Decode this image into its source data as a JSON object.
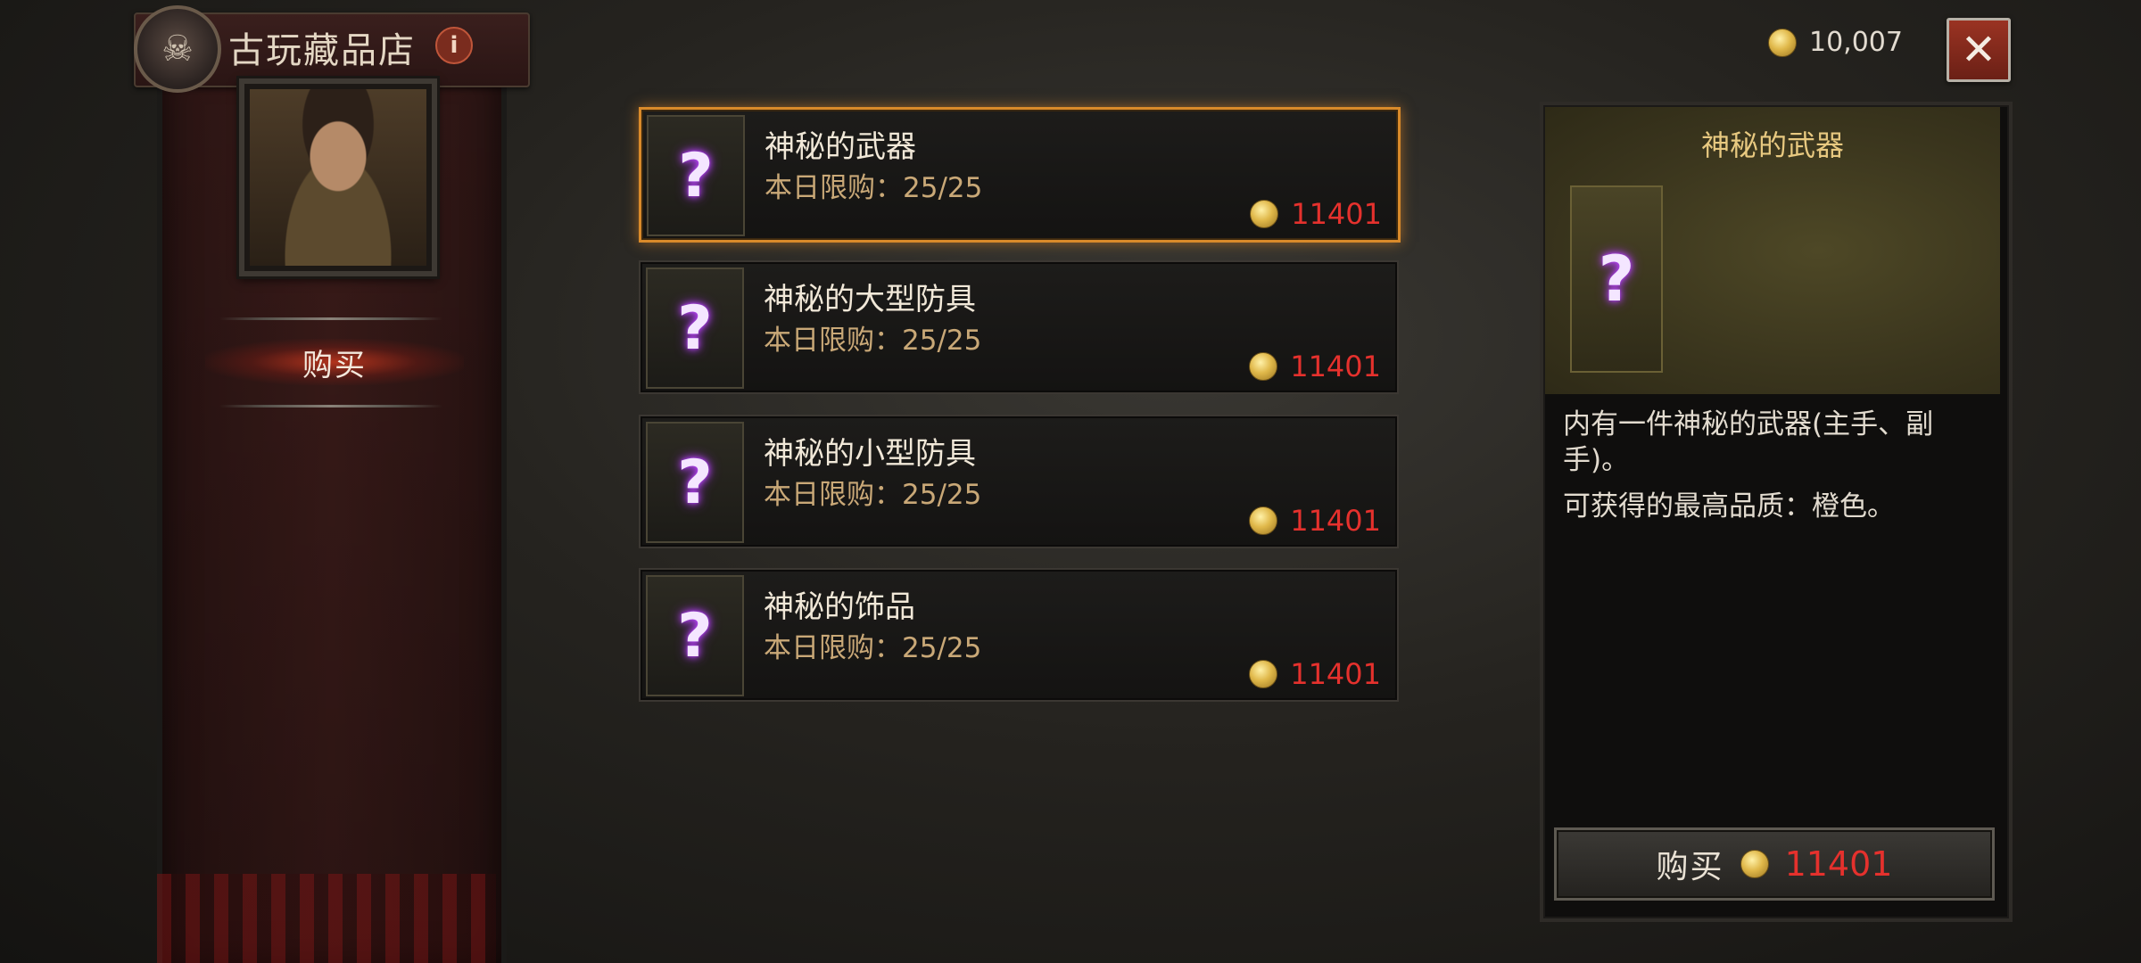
{
  "header": {
    "vendor_title": "古玩藏品店",
    "info_icon": "i",
    "emblem_icon": "skull-emblem"
  },
  "sidebar": {
    "tabs": [
      {
        "label": "购买",
        "active": true
      }
    ]
  },
  "wallet": {
    "gold": "10,007",
    "coin_icon": "gold-coin"
  },
  "close_icon": "✕",
  "items": [
    {
      "name": "神秘的武器",
      "limit": "本日限购：25/25",
      "price": "11401",
      "icon": "mystery-weapon",
      "selected": true
    },
    {
      "name": "神秘的大型防具",
      "limit": "本日限购：25/25",
      "price": "11401",
      "icon": "mystery-large-armor",
      "selected": false
    },
    {
      "name": "神秘的小型防具",
      "limit": "本日限购：25/25",
      "price": "11401",
      "icon": "mystery-small-armor",
      "selected": false
    },
    {
      "name": "神秘的饰品",
      "limit": "本日限购：25/25",
      "price": "11401",
      "icon": "mystery-jewelry",
      "selected": false
    }
  ],
  "detail": {
    "title": "神秘的武器",
    "description": "内有一件神秘的武器(主手、副手)。",
    "quality": "可获得的最高品质：橙色。",
    "buy_label": "购买",
    "buy_price": "11401"
  },
  "colors": {
    "price_red": "#e5312d",
    "selected_border": "#d98a2a",
    "detail_title": "#e8c980"
  },
  "qmark": "?"
}
